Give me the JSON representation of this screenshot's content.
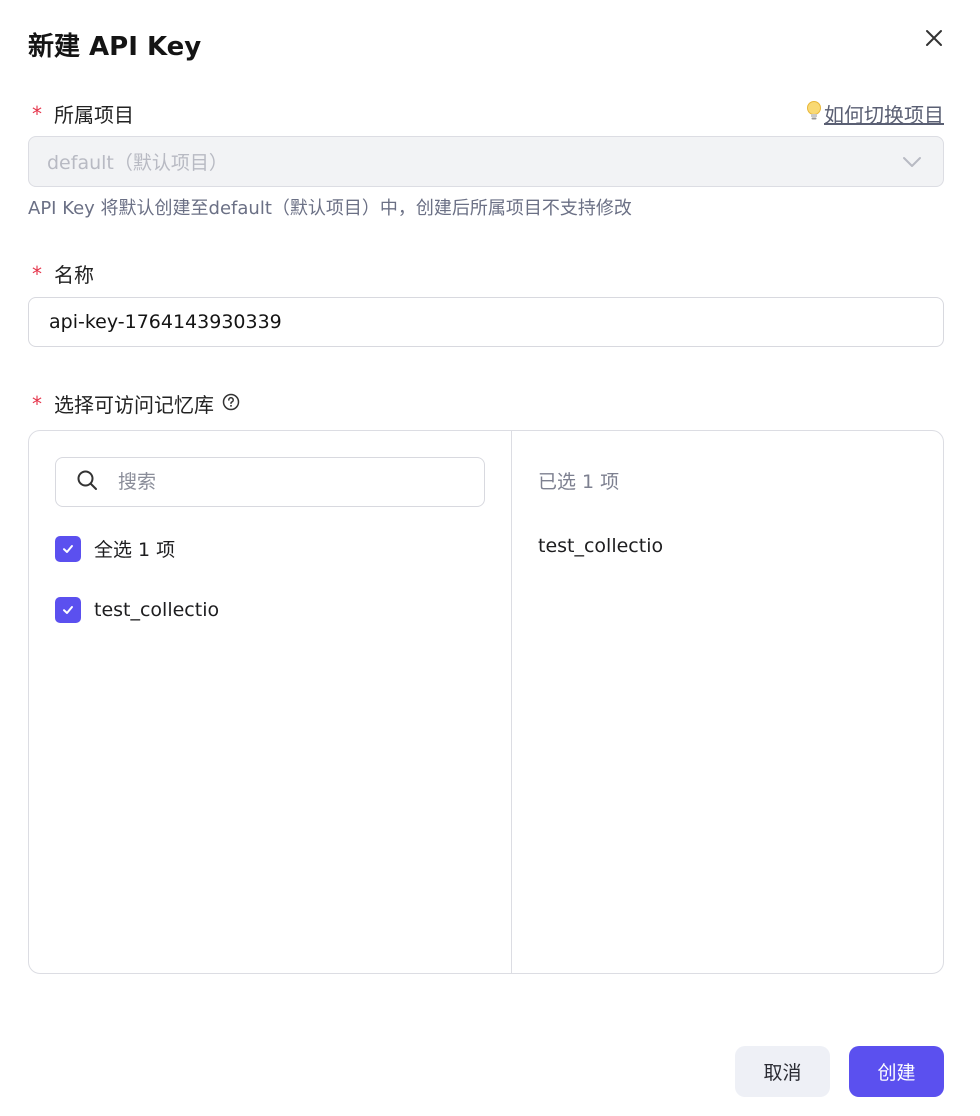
{
  "dialog": {
    "title": "新建 API Key"
  },
  "project": {
    "required_mark": "*",
    "label": "所属项目",
    "help_link": "如何切换项目",
    "selected": "default（默认项目）",
    "hint": "API Key 将默认创建至default（默认项目）中，创建后所属项目不支持修改"
  },
  "name": {
    "required_mark": "*",
    "label": "名称",
    "value": "api-key-1764143930339"
  },
  "collections": {
    "required_mark": "*",
    "label": "选择可访问记忆库",
    "search_placeholder": "搜索",
    "select_all_label": "全选 1 项",
    "items": [
      {
        "label": "test_collectio",
        "checked": true
      }
    ],
    "selected_count_label": "已选 1 项",
    "selected_items": [
      "test_collectio"
    ]
  },
  "footer": {
    "cancel_label": "取消",
    "create_label": "创建"
  },
  "colors": {
    "accent": "#5b50ef",
    "required": "#e5344a"
  }
}
